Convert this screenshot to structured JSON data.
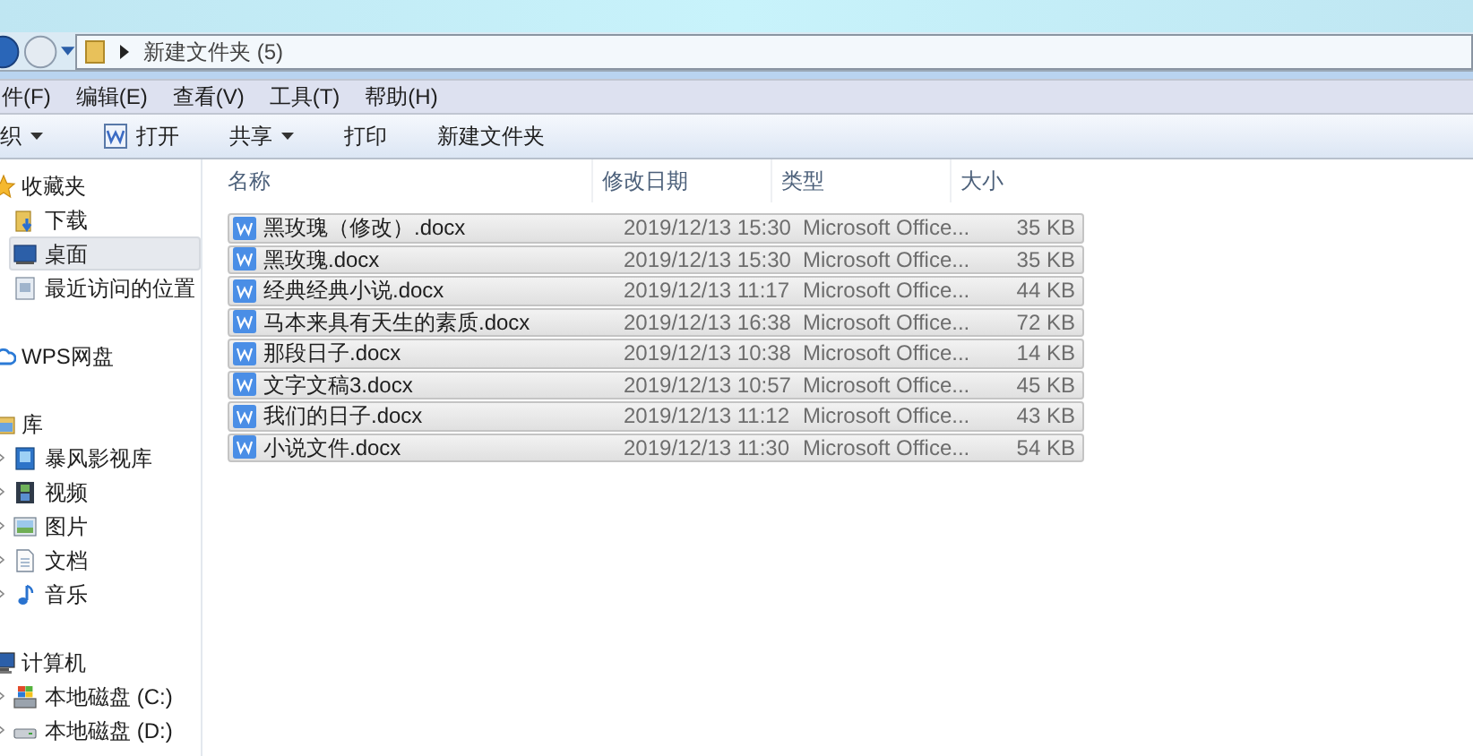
{
  "address_bar": {
    "path": "新建文件夹 (5)"
  },
  "menu": [
    "件(F)",
    "编辑(E)",
    "查看(V)",
    "工具(T)",
    "帮助(H)"
  ],
  "toolbar": [
    {
      "label": "织",
      "kind": "dropdown"
    },
    {
      "label": "打开",
      "kind": "open"
    },
    {
      "label": "共享",
      "kind": "dropdown"
    },
    {
      "label": "打印",
      "kind": "plain"
    },
    {
      "label": "新建文件夹",
      "kind": "plain"
    }
  ],
  "sidebar": {
    "groups": [
      {
        "label": "收藏夹",
        "kind": "star",
        "children": [
          {
            "label": "下载",
            "kind": "download",
            "selected": false
          },
          {
            "label": "桌面",
            "kind": "desktop",
            "selected": true
          },
          {
            "label": "最近访问的位置",
            "kind": "recent",
            "selected": false
          }
        ]
      },
      {
        "label": "WPS网盘",
        "kind": "cloud"
      },
      {
        "label": "库",
        "kind": "library",
        "children": [
          {
            "label": "暴风影视库",
            "kind": "media",
            "selected": false
          },
          {
            "label": "视频",
            "kind": "film",
            "selected": false
          },
          {
            "label": "图片",
            "kind": "image",
            "selected": false
          },
          {
            "label": "文档",
            "kind": "document",
            "selected": false
          },
          {
            "label": "音乐",
            "kind": "music",
            "selected": false
          }
        ]
      },
      {
        "label": "计算机",
        "kind": "computer",
        "children": [
          {
            "label": "本地磁盘 (C:)",
            "kind": "system-drive",
            "selected": false
          },
          {
            "label": "本地磁盘 (D:)",
            "kind": "drive",
            "selected": false
          }
        ]
      }
    ]
  },
  "table": {
    "columns": [
      "名称",
      "修改日期",
      "类型",
      "大小"
    ],
    "rows": [
      {
        "name": "黑玫瑰（修改）.docx",
        "date": "2019/12/13 15:30",
        "type": "Microsoft Office...",
        "size": "35 KB",
        "selected": true
      },
      {
        "name": "黑玫瑰.docx",
        "date": "2019/12/13 15:30",
        "type": "Microsoft Office...",
        "size": "35 KB",
        "selected": true
      },
      {
        "name": "经典经典小说.docx",
        "date": "2019/12/13 11:17",
        "type": "Microsoft Office...",
        "size": "44 KB",
        "selected": true
      },
      {
        "name": "马本来具有天生的素质.docx",
        "date": "2019/12/13 16:38",
        "type": "Microsoft Office...",
        "size": "72 KB",
        "selected": true
      },
      {
        "name": "那段日子.docx",
        "date": "2019/12/13 10:38",
        "type": "Microsoft Office...",
        "size": "14 KB",
        "selected": true
      },
      {
        "name": "文字文稿3.docx",
        "date": "2019/12/13 10:57",
        "type": "Microsoft Office...",
        "size": "45 KB",
        "selected": true
      },
      {
        "name": "我们的日子.docx",
        "date": "2019/12/13 11:12",
        "type": "Microsoft Office...",
        "size": "43 KB",
        "selected": true
      },
      {
        "name": "小说文件.docx",
        "date": "2019/12/13 11:30",
        "type": "Microsoft Office...",
        "size": "54 KB",
        "selected": true
      }
    ]
  }
}
